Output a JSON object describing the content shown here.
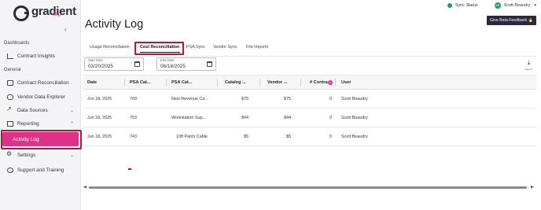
{
  "brand": {
    "name": "gradient",
    "sub": "msp"
  },
  "sidebar": {
    "collapse_icon": "chevron-left-icon",
    "sections": [
      {
        "label": "Dashboards"
      },
      {
        "label": "General"
      }
    ],
    "items": [
      {
        "label": "Contract Insights",
        "icon": "chart-icon"
      },
      {
        "label": "Contract Reconciliation",
        "icon": "reconcile-icon"
      },
      {
        "label": "Vendor Data Explorer",
        "icon": "database-icon"
      },
      {
        "label": "Data Sources",
        "icon": "plug-icon"
      },
      {
        "label": "Reporting",
        "icon": "report-icon"
      },
      {
        "label": "Activity Log",
        "icon": "",
        "active": true
      },
      {
        "label": "Settings",
        "icon": "gear-icon"
      },
      {
        "label": "Support and Training",
        "icon": "help-icon"
      }
    ],
    "accent_color": "#e0318a"
  },
  "topbar": {
    "sync_label": "Sync Status",
    "sync_color": "#1e9e5a",
    "user_name": "Scott Beaudry",
    "beta_label": "Give Beta Feedback 🔥"
  },
  "page": {
    "title": "Activity Log"
  },
  "tabs": [
    {
      "label": "Usage Reconciliation"
    },
    {
      "label": "Cost Reconciliation",
      "active": true
    },
    {
      "label": "PSA Sync"
    },
    {
      "label": "Vendor Sync"
    },
    {
      "label": "File Imports"
    }
  ],
  "filters": {
    "start": {
      "label": "Start Date",
      "value": "03/20/2025"
    },
    "end": {
      "label": "End Date",
      "value": "06/18/2025"
    }
  },
  "export_label": "Export",
  "table": {
    "columns": [
      "Date",
      "PSA Cat...",
      "PSA Cat...",
      "Catalog ...",
      "Vendor ...",
      "# Contra",
      "User"
    ],
    "count_badge": "1",
    "rows": [
      [
        "Jun 18, 2025",
        "769",
        "New Revenue Ca...",
        "$75",
        "$75",
        "0",
        "Scott Beaudry"
      ],
      [
        "Jun 18, 2025",
        "753",
        "Workstation Sup...",
        "$44",
        "$44",
        "0",
        "Scott Beaudry"
      ],
      [
        "Jun 18, 2025",
        "743",
        "10ft Patch Cable",
        "$5",
        "$5",
        "0",
        "Scott Beaudry"
      ]
    ]
  }
}
